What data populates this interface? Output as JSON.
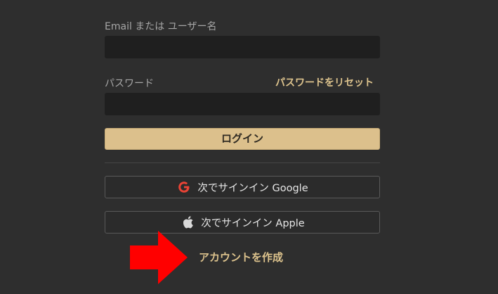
{
  "login_form": {
    "email_label": "Email または ユーザー名",
    "email_value": "",
    "password_label": "パスワード",
    "password_value": "",
    "reset_password_link": "パスワードをリセット",
    "login_button": "ログイン",
    "google_button": {
      "label": "次でサインイン Google",
      "icon": "google-icon"
    },
    "apple_button": {
      "label": "次でサインイン Apple",
      "icon": "apple-icon"
    },
    "create_account_link": "アカウントを作成"
  },
  "colors": {
    "background": "#2e2e2e",
    "input_background": "#1f1f1f",
    "accent": "#dcc08c",
    "accent_text": "#ddc38d",
    "google_red": "#ea4335",
    "annotation_arrow": "#ff0000"
  },
  "annotation": {
    "icon": "red-arrow-icon"
  }
}
